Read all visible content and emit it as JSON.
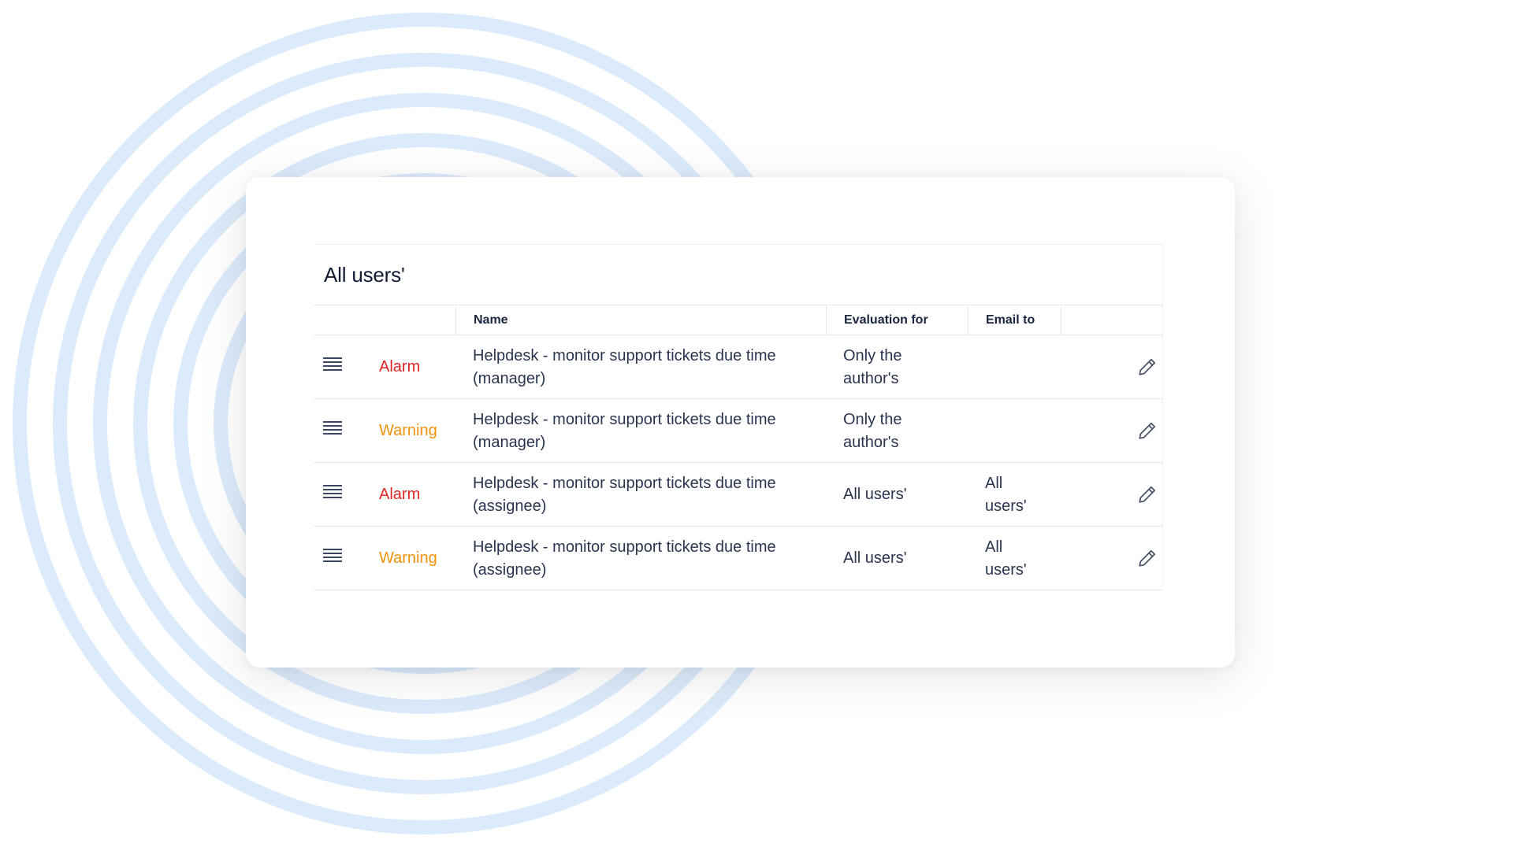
{
  "colors": {
    "alarm": "#e02424",
    "warning": "#f0920c",
    "ring": "#dcebfb"
  },
  "panel": {
    "title": "All users'"
  },
  "table": {
    "headers": {
      "name": "Name",
      "evaluation": "Evaluation for",
      "email": "Email to"
    },
    "rows": [
      {
        "level": "Alarm",
        "name": "Helpdesk - monitor support tickets due time (manager)",
        "evaluation": "Only the author's",
        "email": ""
      },
      {
        "level": "Warning",
        "name": "Helpdesk - monitor support tickets due time (manager)",
        "evaluation": "Only the author's",
        "email": ""
      },
      {
        "level": "Alarm",
        "name": "Helpdesk - monitor support tickets due time (assignee)",
        "evaluation": "All users'",
        "email": "All users'"
      },
      {
        "level": "Warning",
        "name": "Helpdesk - monitor support tickets due time (assignee)",
        "evaluation": "All users'",
        "email": "All users'"
      }
    ]
  },
  "icons": {
    "drag": "hamburger-drag-icon",
    "edit": "pencil-icon"
  }
}
